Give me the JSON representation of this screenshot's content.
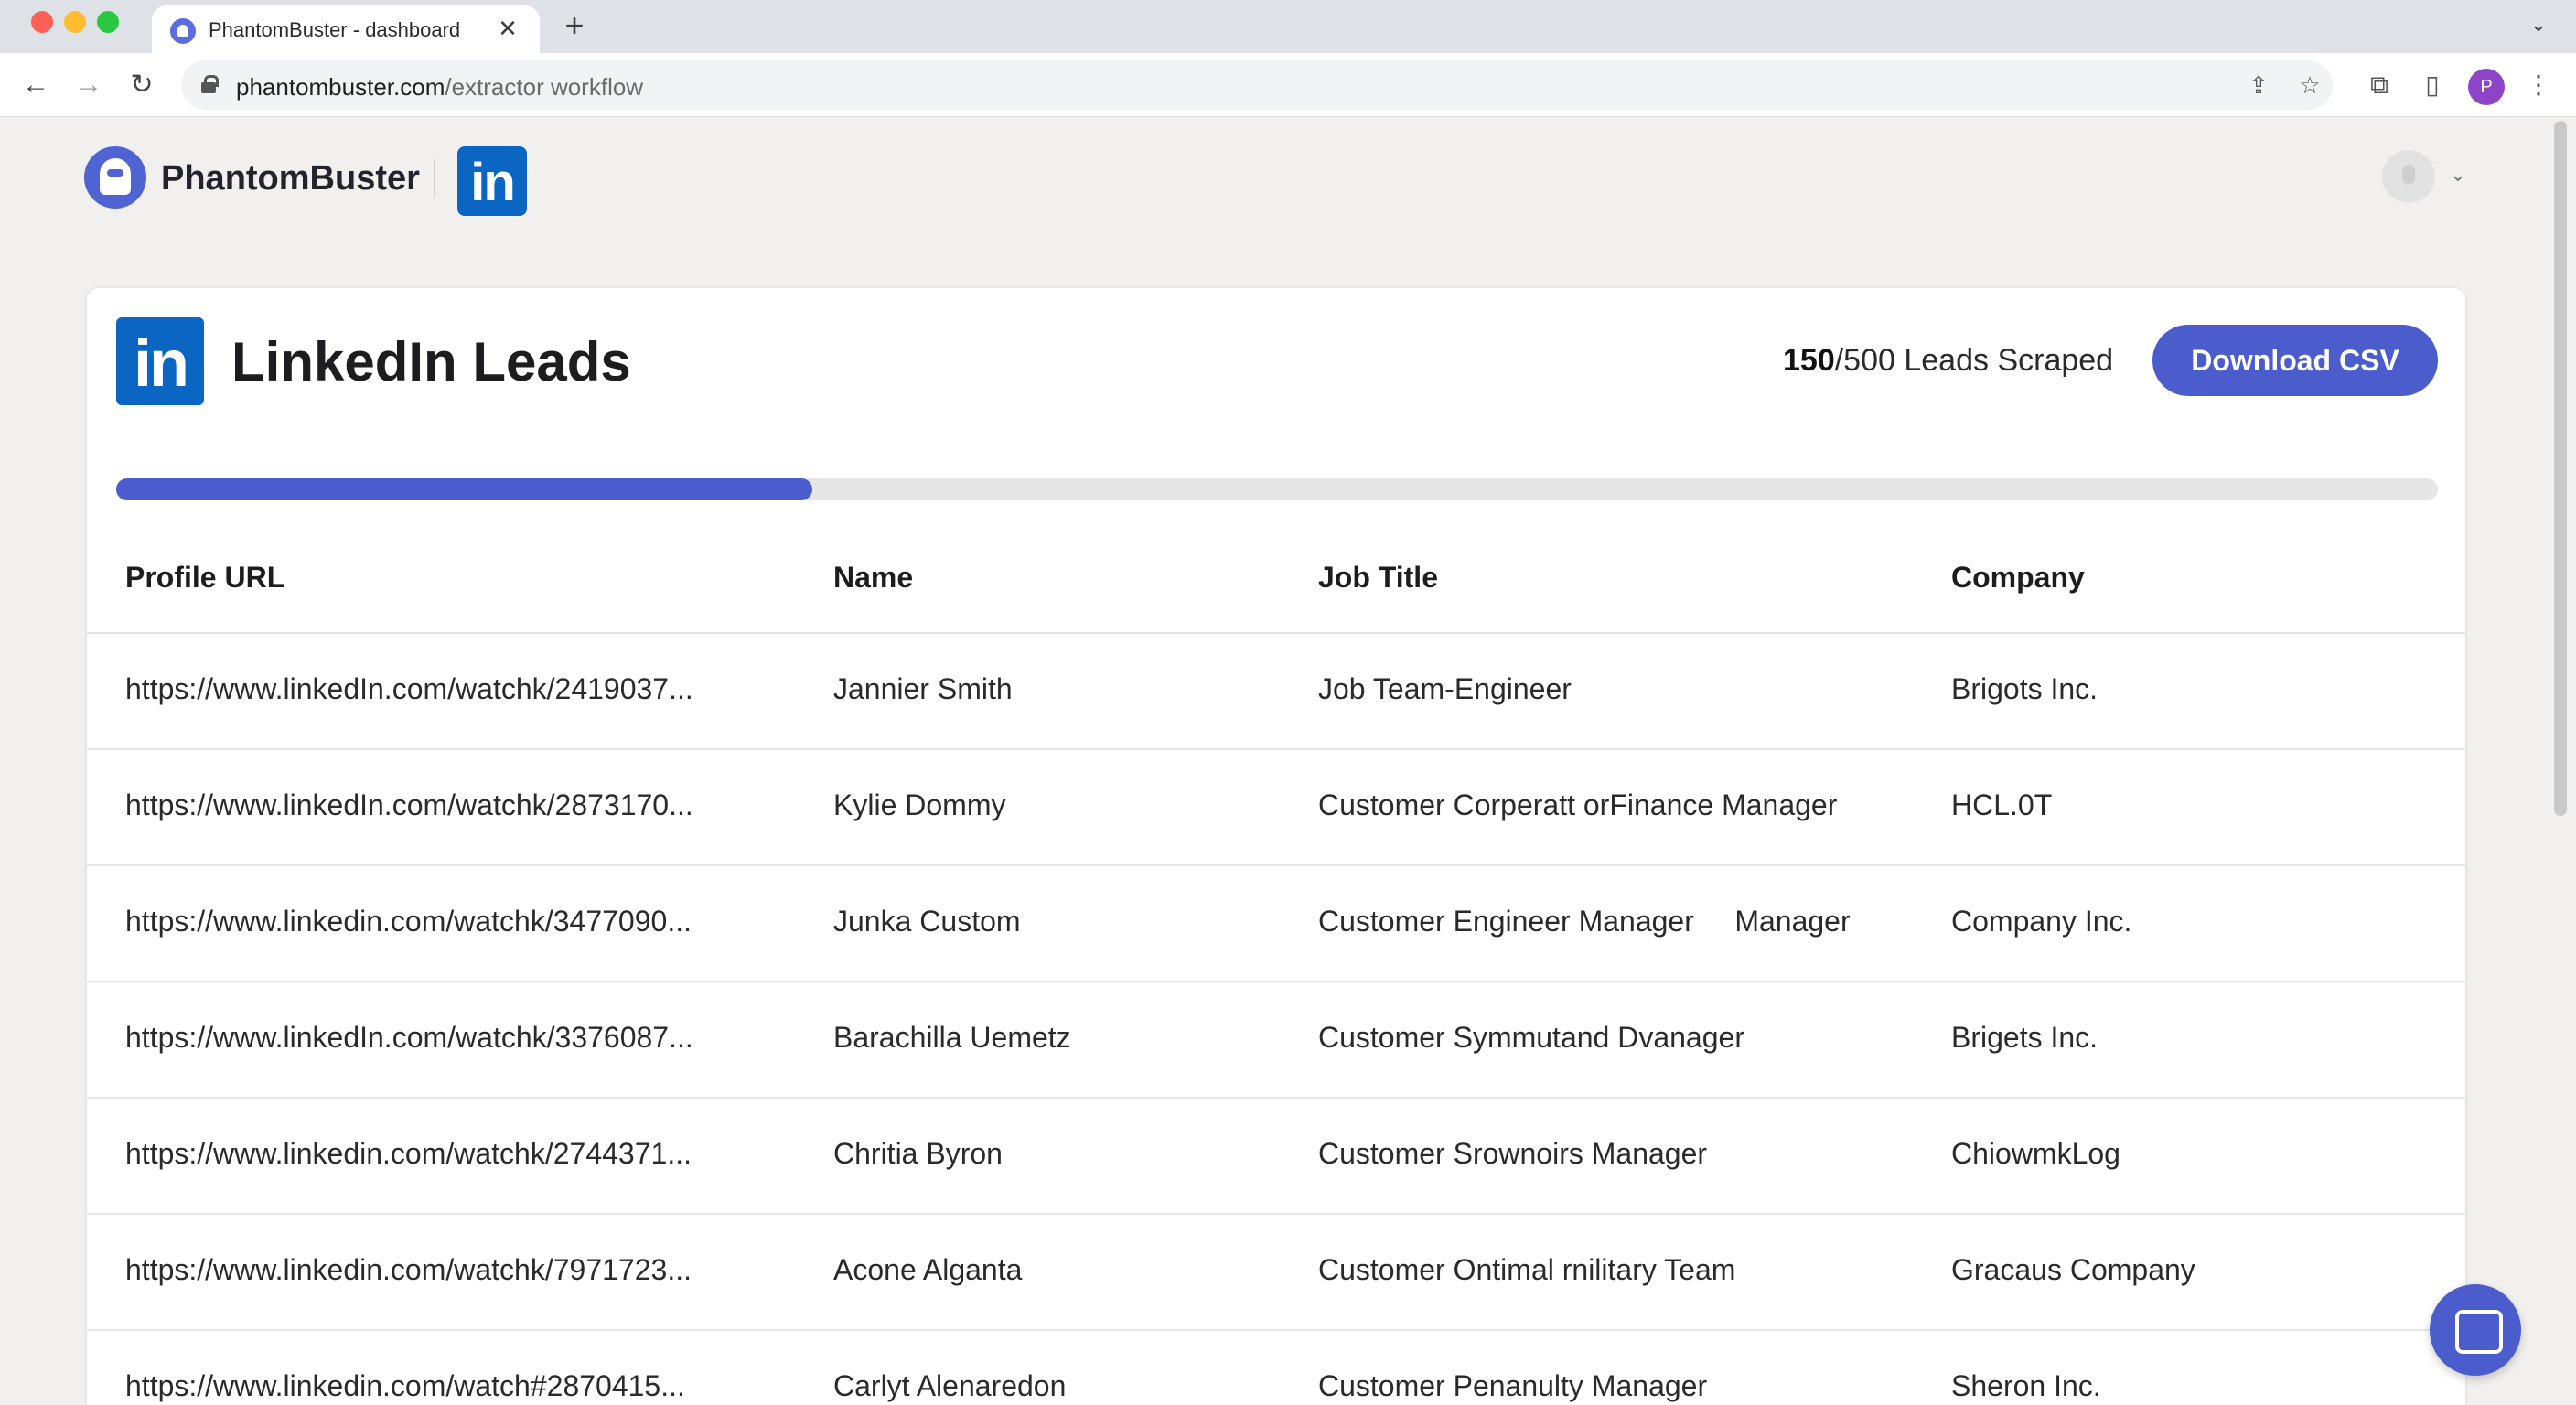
{
  "browser": {
    "tab_title": "PhantomBuster - dashboard",
    "tab_close": "✕",
    "new_tab": "+",
    "url_host": "phantombuster.com",
    "url_path": "/extractor workflow",
    "profile_initial": "P"
  },
  "header": {
    "brand_name": "PhantomBuster",
    "linkedin_badge": "in"
  },
  "card": {
    "linkedin_badge": "in",
    "title": "LinkedIn Leads",
    "scraped": "150",
    "total_label": "/500 Leads Scraped",
    "progress": 0.3,
    "download_label": "Download CSV"
  },
  "table": {
    "columns": [
      "Profile URL",
      "Name",
      "Job Title",
      "Company"
    ],
    "rows": [
      [
        "https://www.linkedIn.com/watchk/2419037...",
        "Jannier Smith",
        "Job Team-Engineer",
        "Brigots Inc."
      ],
      [
        "https://www.linkedIn.com/watchk/2873170...",
        "Kylie Dommy",
        "Customer Corperatt orFinance Manager",
        "HCL.0T"
      ],
      [
        "https://www.linkedin.com/watchk/3477090...",
        "Junka Custom",
        "Customer Engineer Manager     Manager",
        "Company Inc."
      ],
      [
        "https://www.linkedIn.com/watchk/3376087...",
        "Barachilla Uemetz",
        "Customer Symmutand Dvanager",
        "Brigets Inc."
      ],
      [
        "https://www.linkedin.com/watchk/2744371...",
        "Chritia Byron",
        "Customer Srownoirs Manager",
        "ChiowmkLog"
      ],
      [
        "https://www.linkedin.com/watchk/7971723...",
        "Acone Alganta",
        "Customer Ontimal rnilitary Team",
        "Gracaus Company"
      ],
      [
        "https://www.linkedin.com/watch#2870415...",
        "Carlyt Alenaredon",
        "Customer Penanulty Manager",
        "Sheron Inc."
      ]
    ]
  },
  "icons": {
    "back": "←",
    "forward": "→",
    "reload": "↻",
    "share": "⇪",
    "star": "☆",
    "extensions": "⧉",
    "side_panel": "▯",
    "menu": "⋮",
    "tabs_menu": "⌄",
    "user_caret": "⌄"
  },
  "colors": {
    "accent": "#4b5ccc",
    "linkedin": "#0a66c2"
  }
}
